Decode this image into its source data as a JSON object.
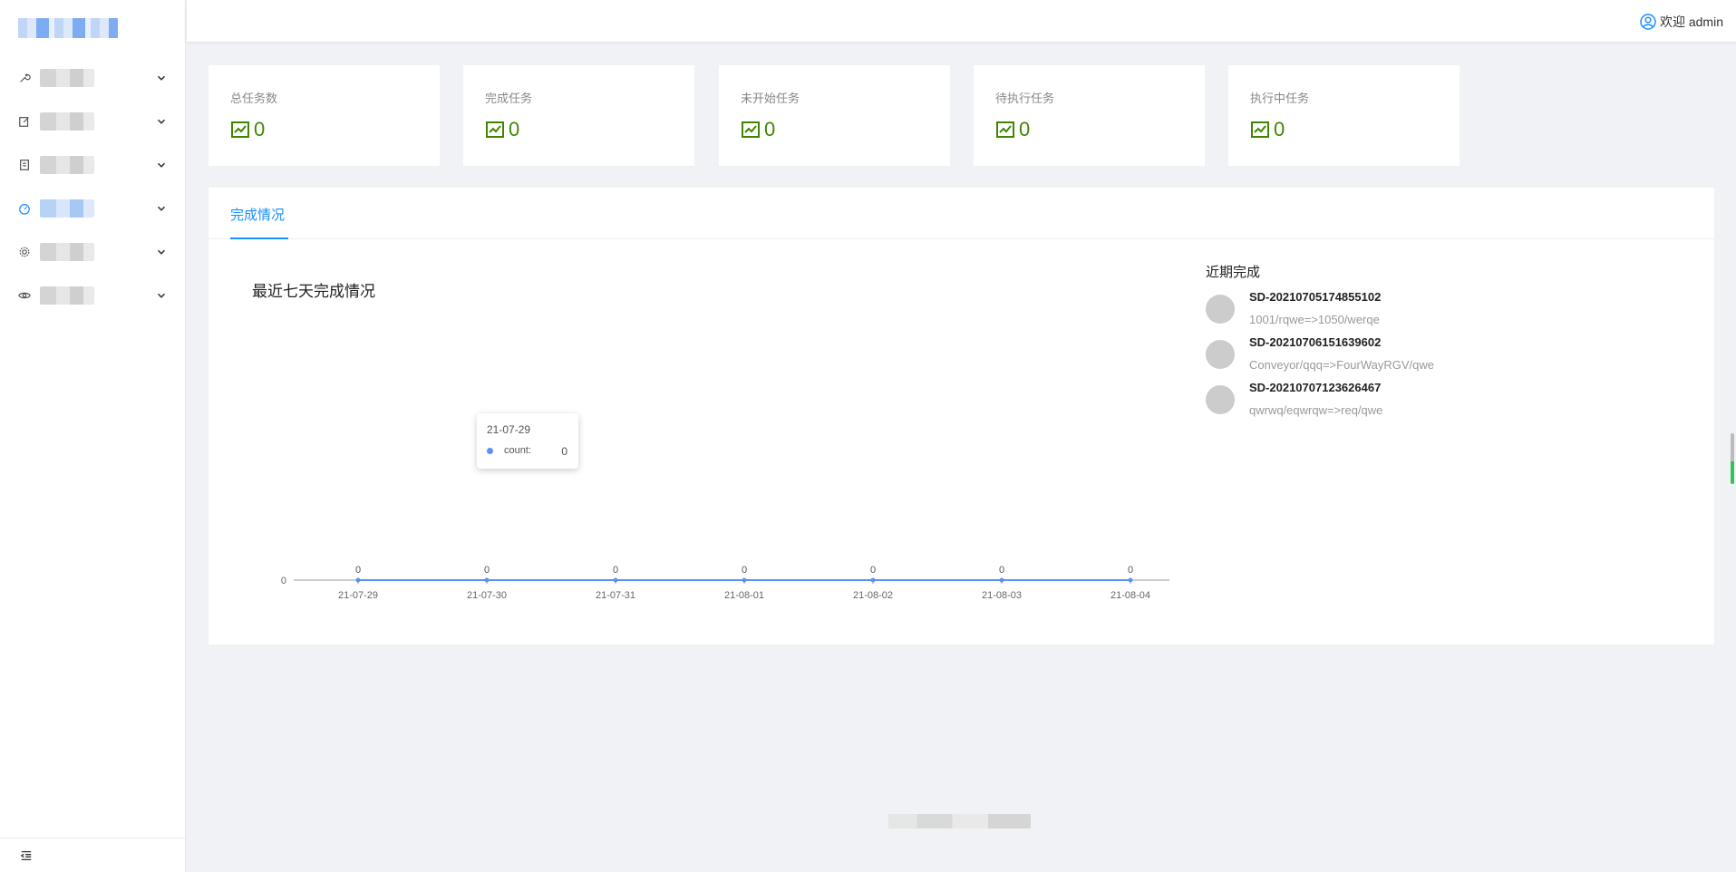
{
  "header": {
    "welcome_text": "欢迎 admin"
  },
  "sidebar": {
    "items": [
      {
        "icon": "wrench-icon",
        "label": ""
      },
      {
        "icon": "edit-icon",
        "label": ""
      },
      {
        "icon": "book-icon",
        "label": ""
      },
      {
        "icon": "dashboard-icon",
        "label": "",
        "active": true
      },
      {
        "icon": "gear-icon",
        "label": ""
      },
      {
        "icon": "eye-icon",
        "label": ""
      }
    ],
    "collapse_icon": "menu-fold-icon"
  },
  "stats": [
    {
      "title": "总任务数",
      "value": "0"
    },
    {
      "title": "完成任务",
      "value": "0"
    },
    {
      "title": "未开始任务",
      "value": "0"
    },
    {
      "title": "待执行任务",
      "value": "0"
    },
    {
      "title": "执行中任务",
      "value": "0"
    }
  ],
  "panel": {
    "tab_label": "完成情况",
    "chart_title": "最近七天完成情况",
    "recent_title": "近期完成",
    "recent": [
      {
        "code": "SD-20210705174855102",
        "route": "1001/rqwe=>1050/werqe"
      },
      {
        "code": "SD-20210706151639602",
        "route": "Conveyor/qqq=>FourWayRGV/qwe"
      },
      {
        "code": "SD-20210707123626467",
        "route": "qwrwq/eqwrqw=>req/qwe"
      }
    ],
    "tooltip": {
      "date": "21-07-29",
      "name": "count:",
      "value": "0"
    }
  },
  "chart_data": {
    "type": "line",
    "x": [
      "21-07-29",
      "21-07-30",
      "21-07-31",
      "21-08-01",
      "21-08-02",
      "21-08-03",
      "21-08-04"
    ],
    "series": [
      {
        "name": "count",
        "values": [
          0,
          0,
          0,
          0,
          0,
          0,
          0
        ]
      }
    ],
    "ytick_labels": [
      "0"
    ],
    "data_labels": true,
    "color": "#5b8ff9"
  },
  "colors": {
    "accent": "#1890ff",
    "stat_green": "#3f8600"
  }
}
